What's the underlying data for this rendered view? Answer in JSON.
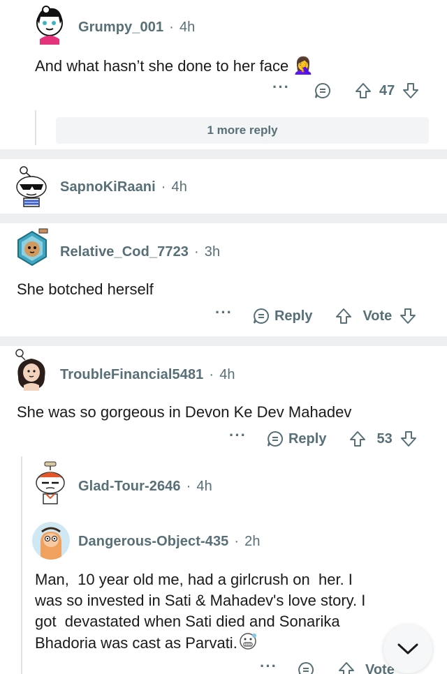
{
  "comments": [
    {
      "username": "Grumpy_001",
      "time": "4h",
      "body": "And what hasn’t she done to her face",
      "emoji": "🤦‍♀️",
      "votes": "47"
    },
    {
      "more_replies": "1 more reply"
    },
    {
      "username": "SapnoKiRaani",
      "time": "4h"
    },
    {
      "username": "Relative_Cod_7723",
      "time": "3h",
      "body": "She botched herself",
      "reply_label": "Reply",
      "vote_label": "Vote"
    },
    {
      "username": "TroubleFinancial5481",
      "time": "4h",
      "body": "She was so gorgeous in Devon Ke Dev Mahadev",
      "reply_label": "Reply",
      "votes": "53"
    },
    {
      "username": "Glad-Tour-2646",
      "time": "4h"
    },
    {
      "username": "Dangerous-Object-435",
      "time": "2h",
      "body_lines": [
        "Man,  10 year old me, had a girlcrush on  her. I",
        "was so invested in Sati & Mahadev's love story. I",
        "got  devastated when Sati died and Sonarika",
        "Bhadoria was cast as Parvati."
      ],
      "vote_label": "Vote"
    }
  ],
  "colors": {
    "text": "#1a1a1b",
    "meta": "#576f76",
    "divider": "#edeff1"
  }
}
